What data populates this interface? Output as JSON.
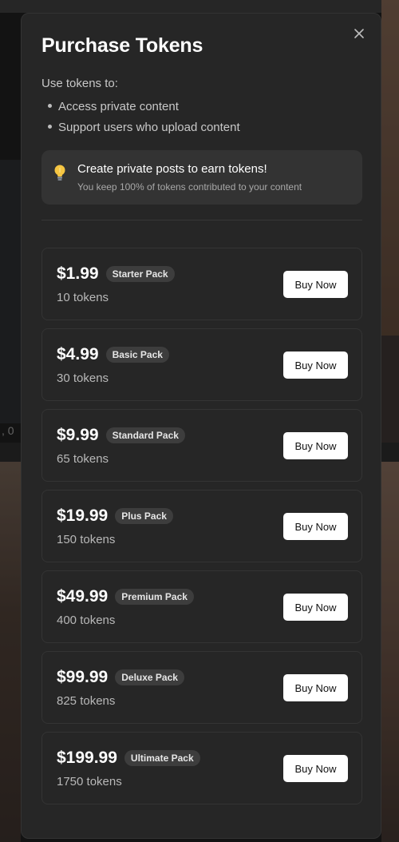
{
  "modal": {
    "title": "Purchase Tokens",
    "intro": "Use tokens to:",
    "uses": [
      "Access private content",
      "Support users who upload content"
    ],
    "tip": {
      "icon": "lightbulb-icon",
      "title": "Create private posts to earn tokens!",
      "subtitle": "You keep 100% of tokens contributed to your content"
    },
    "close_icon": "close-icon"
  },
  "background": {
    "count_text": ", 0"
  },
  "packs": [
    {
      "price": "$1.99",
      "name": "Starter Pack",
      "tokens": "10 tokens",
      "button": "Buy Now"
    },
    {
      "price": "$4.99",
      "name": "Basic Pack",
      "tokens": "30 tokens",
      "button": "Buy Now"
    },
    {
      "price": "$9.99",
      "name": "Standard Pack",
      "tokens": "65 tokens",
      "button": "Buy Now"
    },
    {
      "price": "$19.99",
      "name": "Plus Pack",
      "tokens": "150 tokens",
      "button": "Buy Now"
    },
    {
      "price": "$49.99",
      "name": "Premium Pack",
      "tokens": "400 tokens",
      "button": "Buy Now"
    },
    {
      "price": "$99.99",
      "name": "Deluxe Pack",
      "tokens": "825 tokens",
      "button": "Buy Now"
    },
    {
      "price": "$199.99",
      "name": "Ultimate Pack",
      "tokens": "1750 tokens",
      "button": "Buy Now"
    }
  ],
  "colors": {
    "modal_bg": "#262626",
    "card_border": "#343434",
    "badge_bg": "#3d3d3d",
    "button_bg": "#ffffff",
    "tip_bg": "#333333",
    "lightbulb": "#f5c542"
  }
}
